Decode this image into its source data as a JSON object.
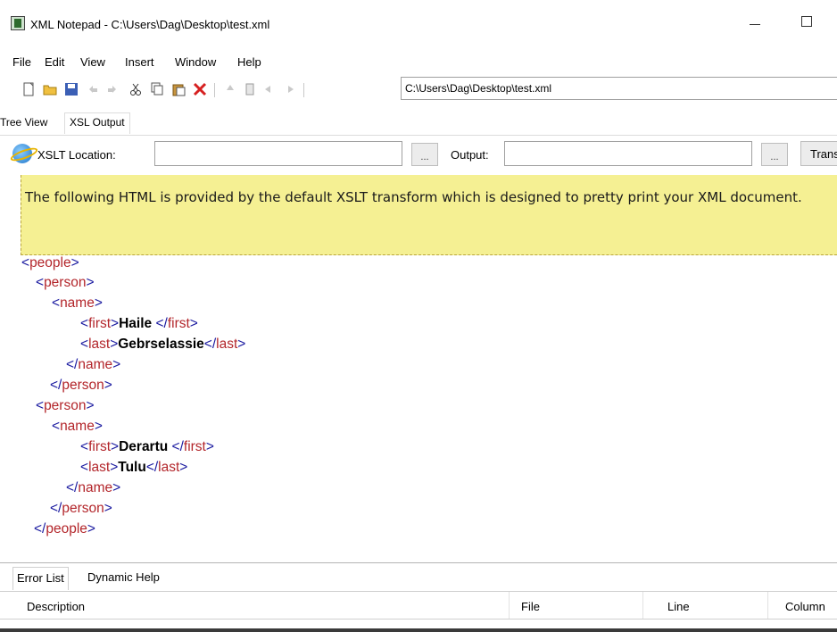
{
  "window": {
    "title": "XML Notepad - C:\\Users\\Dag\\Desktop\\test.xml"
  },
  "menu": [
    "File",
    "Edit",
    "View",
    "Insert",
    "Window",
    "Help"
  ],
  "toolbar": {
    "icons": [
      "new-file-icon",
      "open-folder-icon",
      "save-icon",
      "undo-icon",
      "redo-icon",
      "cut-icon",
      "copy-icon",
      "paste-icon",
      "delete-icon",
      "nudge-up-icon",
      "nudge-down-icon",
      "nudge-left-icon",
      "nudge-right-icon"
    ],
    "path_value": "C:\\Users\\Dag\\Desktop\\test.xml"
  },
  "view_tabs": {
    "tree_view": "Tree View",
    "xsl_output": "XSL Output"
  },
  "xslt_bar": {
    "location_label": "XSLT Location:",
    "location_value": "",
    "browse_label": "...",
    "output_label": "Output:",
    "output_value": "",
    "output_browse_label": "...",
    "transform_label": "Transform"
  },
  "notice": {
    "text": "The following HTML is provided by the default XSLT transform which is designed to pretty print your XML document."
  },
  "xml": {
    "root_tag": "people",
    "persons": [
      {
        "first": "Haile ",
        "last": "Gebrselassie"
      },
      {
        "first": "Derartu ",
        "last": "Tulu"
      }
    ],
    "person_tag": "person",
    "name_tag": "name",
    "first_tag": "first",
    "last_tag": "last"
  },
  "bottom_tabs": {
    "error_list": "Error List",
    "dynamic_help": "Dynamic Help"
  },
  "error_columns": {
    "description": "Description",
    "file": "File",
    "line": "Line",
    "column": "Column"
  },
  "colors": {
    "notice_bg": "#f5f093",
    "tag_color": "#b3262b",
    "bracket_color": "#1a1aa0"
  }
}
